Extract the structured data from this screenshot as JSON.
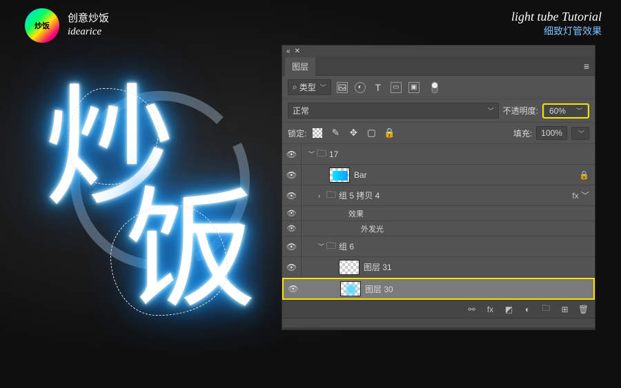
{
  "brand": {
    "cn": "创意炒饭",
    "en": "idearice",
    "logo_text": "炒饭"
  },
  "tutorial": {
    "title_en": "light tube Tutorial",
    "title_cn": "细致灯管效果"
  },
  "neon": {
    "char1": "炒",
    "char2": "饭"
  },
  "panel": {
    "title": "图层",
    "filter_label": "类型",
    "blend_mode": "正常",
    "opacity_label": "不透明度:",
    "opacity_value": "60%",
    "lock_label": "锁定:",
    "fill_label": "填充:",
    "fill_value": "100%"
  },
  "layers": {
    "group17": "17",
    "bar": "Bar",
    "group5copy4": "组 5 拷贝 4",
    "effects": "效果",
    "outerglow": "外发光",
    "group6": "组 6",
    "layer31": "图层 31",
    "layer30": "图层 30",
    "fx_label": "fx"
  }
}
